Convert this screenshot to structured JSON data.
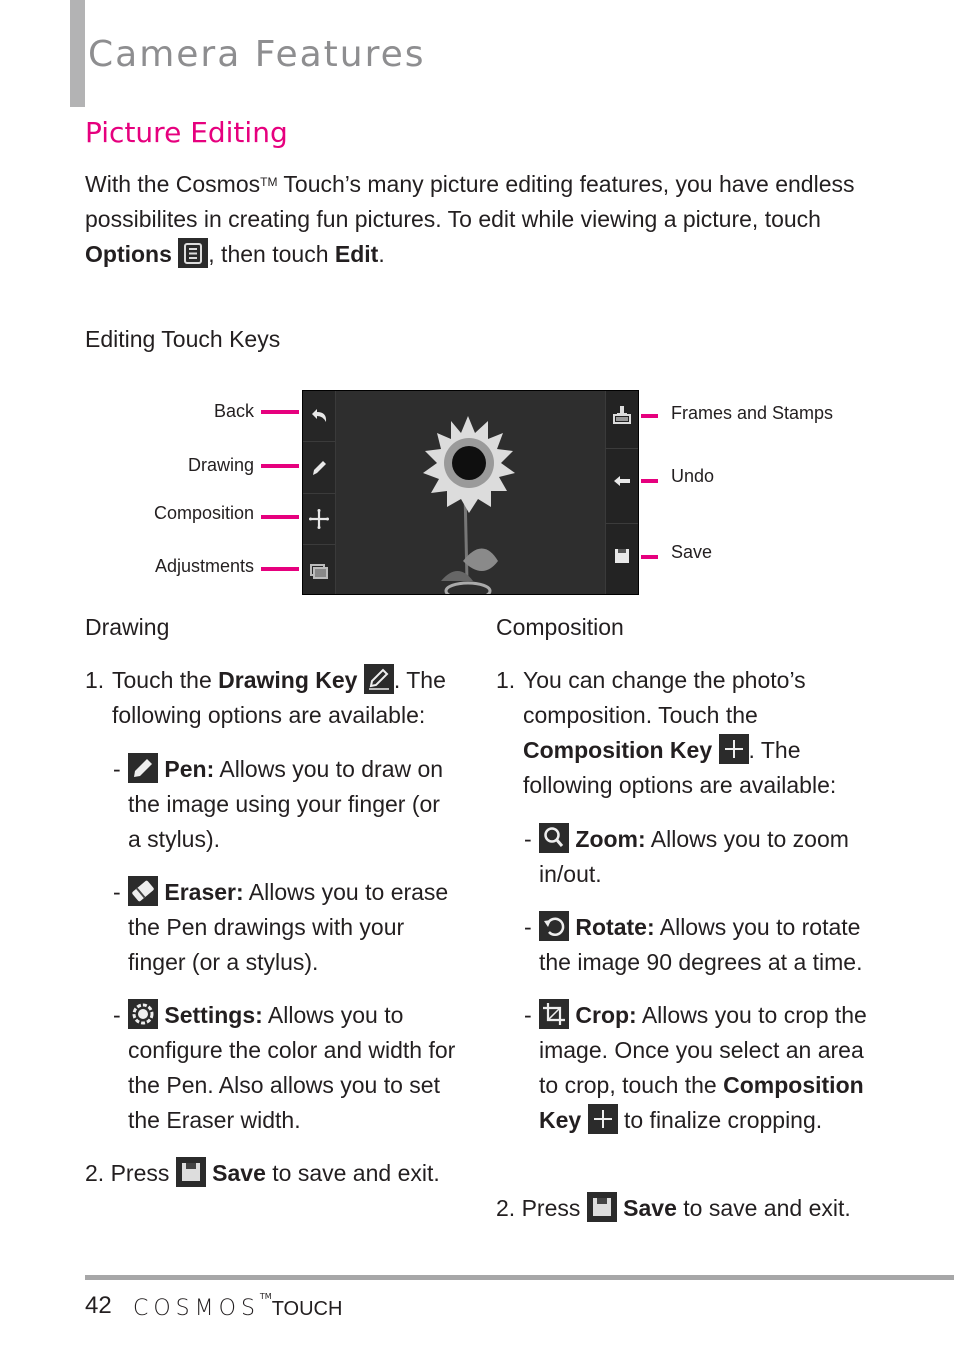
{
  "header": {
    "chapter_title": "Camera Features",
    "section_title": "Picture Editing"
  },
  "intro": {
    "text_1": "With the Cosmos",
    "tm": "TM",
    "text_2": " Touch’s many picture editing features, you have endless possibilites in creating fun pictures. To edit while viewing a picture, touch ",
    "options_label": "Options",
    "options_icon": "menu-icon",
    "text_3": ", then touch ",
    "edit_label": "Edit",
    "text_4": "."
  },
  "touch_keys": {
    "heading": "Editing Touch Keys",
    "left_keys": [
      {
        "label": "Back",
        "icon": "back-arrow-icon"
      },
      {
        "label": "Drawing",
        "icon": "pencil-icon"
      },
      {
        "label": "Composition",
        "icon": "move-cross-icon"
      },
      {
        "label": "Adjustments",
        "icon": "layers-icon"
      }
    ],
    "right_keys": [
      {
        "label": "Frames and Stamps",
        "icon": "stamp-icon"
      },
      {
        "label": "Undo",
        "icon": "left-arrow-icon"
      },
      {
        "label": "Save",
        "icon": "floppy-disk-icon"
      }
    ],
    "callout_color": "#e6007e"
  },
  "drawing": {
    "heading": "Drawing",
    "step1_num": "1.",
    "step1_text_a": "Touch the ",
    "step1_key": "Drawing Key",
    "step1_text_b": ". The following options are available:",
    "options": [
      {
        "icon": "pen-icon",
        "name": "Pen:",
        "desc": " Allows you to draw on the image using your finger (or a stylus)."
      },
      {
        "icon": "eraser-icon",
        "name": "Eraser:",
        "desc": " Allows you to erase the Pen drawings with your finger (or a stylus)."
      },
      {
        "icon": "settings-gear-icon",
        "name": "Settings:",
        "desc": " Allows you to configure the color and width for the Pen. Also allows you to set the Eraser width."
      }
    ],
    "step2_num": "2.",
    "step2_text_a": "Press ",
    "step2_key": "Save",
    "step2_text_b": " to save and exit."
  },
  "composition": {
    "heading": "Composition",
    "step1_num": "1.",
    "step1_text_a": "You can change the photo’s composition. Touch the ",
    "step1_key": "Composition Key",
    "step1_text_b": ". The following options are available:",
    "options": [
      {
        "icon": "zoom-magnifier-icon",
        "name": "Zoom:",
        "desc": " Allows you to zoom in/out."
      },
      {
        "icon": "rotate-icon",
        "name": "Rotate:",
        "desc": " Allows you to rotate the image 90 degrees at a time."
      },
      {
        "icon": "crop-icon",
        "name": "Crop:",
        "desc": " Allows you to crop the image. Once you select an area to crop, touch the ",
        "key": "Composition Key",
        "desc_b": " to finalize cropping."
      }
    ],
    "step2_num": "2.",
    "step2_text_a": "Press ",
    "step2_key": "Save",
    "step2_text_b": " to save and exit."
  },
  "footer": {
    "page_number": "42",
    "brand": "COSMOS",
    "brand_tm": "TM",
    "brand_suffix": "TOUCH"
  },
  "colors": {
    "accent_magenta": "#e6007e",
    "title_gray": "#8e8e90",
    "rule_gray": "#a7a7a8"
  }
}
